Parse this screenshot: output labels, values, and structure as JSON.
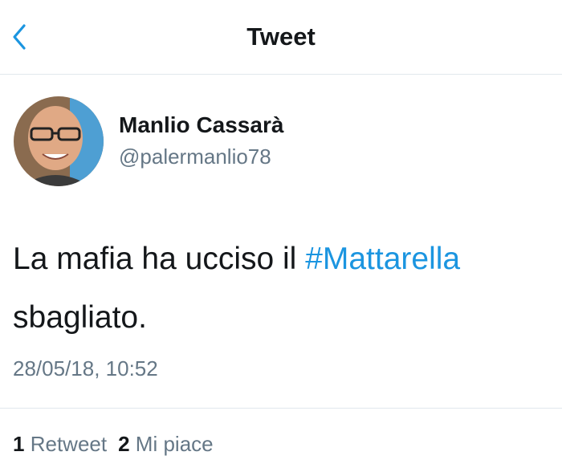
{
  "nav": {
    "title": "Tweet",
    "back_icon": "chevron-left-icon"
  },
  "tweet": {
    "author_name": "Manlio Cassarà",
    "handle": "@palermanlio78",
    "text_before": "La mafia ha ucciso il ",
    "hashtag": "#Mattarella",
    "text_after": "sbagliato.",
    "timestamp": "28/05/18, 10:52",
    "retweets": {
      "count": "1",
      "label": "Retweet"
    },
    "likes": {
      "count": "2",
      "label": "Mi piace"
    }
  },
  "colors": {
    "link": "#1b95e0",
    "secondary": "#657786",
    "divider": "#e1e8ed"
  }
}
